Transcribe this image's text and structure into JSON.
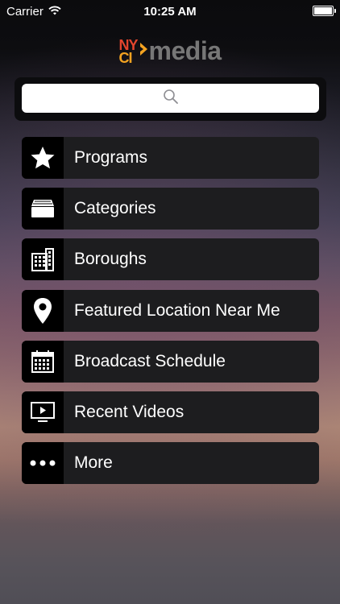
{
  "status_bar": {
    "carrier": "Carrier",
    "time": "10:25 AM"
  },
  "logo": {
    "mark_top": "NY",
    "mark_bottom": "CI",
    "word": "media"
  },
  "search": {
    "placeholder": ""
  },
  "menu": {
    "items": [
      {
        "label": "Programs",
        "icon": "star-icon"
      },
      {
        "label": "Categories",
        "icon": "tray-icon"
      },
      {
        "label": "Boroughs",
        "icon": "buildings-icon"
      },
      {
        "label": "Featured Location Near Me",
        "icon": "map-pin-icon"
      },
      {
        "label": "Broadcast Schedule",
        "icon": "calendar-icon"
      },
      {
        "label": "Recent Videos",
        "icon": "video-screen-icon"
      },
      {
        "label": "More",
        "icon": "more-dots-icon"
      }
    ]
  }
}
